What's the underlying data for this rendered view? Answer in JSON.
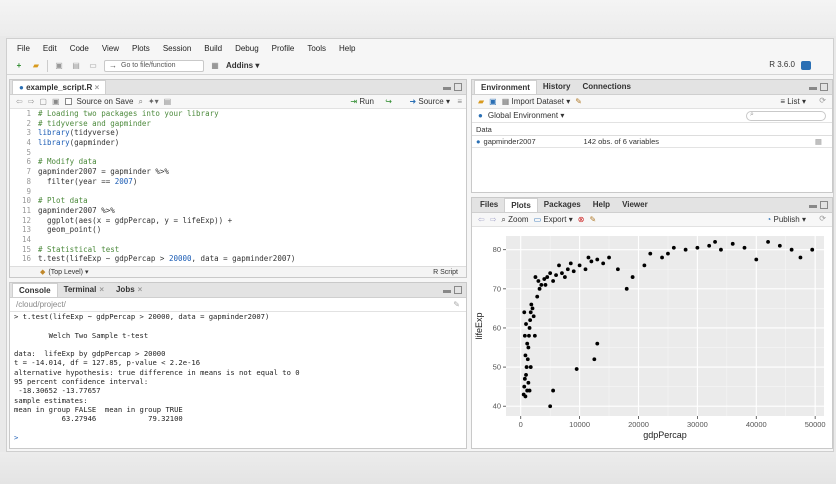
{
  "menu": [
    "File",
    "Edit",
    "Code",
    "View",
    "Plots",
    "Session",
    "Build",
    "Debug",
    "Profile",
    "Tools",
    "Help"
  ],
  "toolbar": {
    "goto_placeholder": "Go to file/function",
    "addins": "Addins",
    "r_version": "R 3.6.0"
  },
  "editor": {
    "tab": "example_script.R",
    "source_on_save": "Source on Save",
    "run": "Run",
    "source": "Source",
    "status_left": "(Top Level)",
    "status_right": "R Script",
    "lines": [
      {
        "n": "1",
        "parts": [
          [
            "cm",
            "# Loading two packages into your library"
          ]
        ]
      },
      {
        "n": "2",
        "parts": [
          [
            "cm",
            "# tidyverse and gapminder"
          ]
        ]
      },
      {
        "n": "3",
        "parts": [
          [
            "fn",
            "library"
          ],
          [
            "",
            "(tidyverse)"
          ]
        ]
      },
      {
        "n": "4",
        "parts": [
          [
            "fn",
            "library"
          ],
          [
            "",
            "(gapminder)"
          ]
        ]
      },
      {
        "n": "5",
        "parts": [
          [
            "",
            ""
          ]
        ]
      },
      {
        "n": "6",
        "parts": [
          [
            "cm",
            "# Modify data"
          ]
        ]
      },
      {
        "n": "7",
        "parts": [
          [
            "",
            "gapminder2007 = gapminder %>%"
          ]
        ]
      },
      {
        "n": "8",
        "parts": [
          [
            "",
            "  filter(year == "
          ],
          [
            "num",
            "2007"
          ],
          [
            "",
            ")"
          ]
        ]
      },
      {
        "n": "9",
        "parts": [
          [
            "",
            ""
          ]
        ]
      },
      {
        "n": "10",
        "parts": [
          [
            "cm",
            "# Plot data"
          ]
        ]
      },
      {
        "n": "11",
        "parts": [
          [
            "",
            "gapminder2007 %>%"
          ]
        ]
      },
      {
        "n": "12",
        "parts": [
          [
            "",
            "  ggplot(aes(x = gdpPercap, y = lifeExp)) +"
          ]
        ]
      },
      {
        "n": "13",
        "parts": [
          [
            "",
            "  geom_point()"
          ]
        ]
      },
      {
        "n": "14",
        "parts": [
          [
            "",
            ""
          ]
        ]
      },
      {
        "n": "15",
        "parts": [
          [
            "cm",
            "# Statistical test"
          ]
        ]
      },
      {
        "n": "16",
        "parts": [
          [
            "",
            "t.test(lifeExp ~ gdpPercap > "
          ],
          [
            "num",
            "20000"
          ],
          [
            "",
            ", data = gapminder2007)"
          ]
        ]
      }
    ]
  },
  "console": {
    "tabs": [
      "Console",
      "Terminal",
      "Jobs"
    ],
    "path": "/cloud/project/",
    "lines": [
      "> t.test(lifeExp ~ gdpPercap > 20000, data = gapminder2007)",
      "",
      "        Welch Two Sample t-test",
      "",
      "data:  lifeExp by gdpPercap > 20000",
      "t = -14.014, df = 127.85, p-value < 2.2e-16",
      "alternative hypothesis: true difference in means is not equal to 0",
      "95 percent confidence interval:",
      " -18.30652 -13.77657",
      "sample estimates:",
      "mean in group FALSE  mean in group TRUE",
      "           63.27946            79.32100",
      "",
      ">"
    ]
  },
  "environment": {
    "tabs": [
      "Environment",
      "History",
      "Connections"
    ],
    "import": "Import Dataset",
    "list": "List",
    "scope": "Global Environment",
    "section": "Data",
    "rows": [
      {
        "name": "gapminder2007",
        "desc": "142 obs. of 6 variables"
      }
    ]
  },
  "plots": {
    "tabs": [
      "Files",
      "Plots",
      "Packages",
      "Help",
      "Viewer"
    ],
    "zoom": "Zoom",
    "export": "Export",
    "publish": "Publish"
  },
  "chart_data": {
    "type": "scatter",
    "xlabel": "gdpPercap",
    "ylabel": "lifeExp",
    "xlim": [
      -2500,
      51500
    ],
    "ylim": [
      37.5,
      83.5
    ],
    "xticks": [
      0,
      10000,
      20000,
      30000,
      40000,
      50000
    ],
    "yticks": [
      40,
      50,
      60,
      70,
      80
    ],
    "points": [
      [
        500,
        43
      ],
      [
        600,
        45
      ],
      [
        700,
        47
      ],
      [
        800,
        42.5
      ],
      [
        900,
        48
      ],
      [
        1000,
        50
      ],
      [
        1100,
        44
      ],
      [
        1200,
        52
      ],
      [
        1300,
        55
      ],
      [
        1400,
        58
      ],
      [
        1500,
        60
      ],
      [
        1600,
        62
      ],
      [
        1700,
        64
      ],
      [
        1800,
        66
      ],
      [
        2000,
        65
      ],
      [
        2200,
        63
      ],
      [
        2500,
        73
      ],
      [
        3000,
        72
      ],
      [
        3500,
        71
      ],
      [
        4000,
        72.5
      ],
      [
        4500,
        73
      ],
      [
        5000,
        74
      ],
      [
        5500,
        72
      ],
      [
        6000,
        73.5
      ],
      [
        7000,
        74
      ],
      [
        8000,
        75
      ],
      [
        9000,
        74.5
      ],
      [
        10000,
        76
      ],
      [
        11000,
        75
      ],
      [
        12000,
        77
      ],
      [
        13000,
        77.5
      ],
      [
        14000,
        76.5
      ],
      [
        18000,
        70
      ],
      [
        19000,
        73
      ],
      [
        21000,
        76
      ],
      [
        24000,
        78
      ],
      [
        25000,
        79
      ],
      [
        28000,
        80
      ],
      [
        30000,
        80.5
      ],
      [
        32000,
        81
      ],
      [
        34000,
        80
      ],
      [
        36000,
        81.5
      ],
      [
        38000,
        80.5
      ],
      [
        40000,
        77.5
      ],
      [
        42000,
        82
      ],
      [
        47500,
        78
      ],
      [
        49500,
        80
      ],
      [
        5000,
        40
      ],
      [
        5500,
        44
      ],
      [
        9500,
        49.5
      ],
      [
        12500,
        52
      ],
      [
        13000,
        56
      ],
      [
        700,
        58
      ],
      [
        900,
        61
      ],
      [
        1100,
        56
      ],
      [
        1300,
        46
      ],
      [
        1500,
        44
      ],
      [
        1700,
        50
      ],
      [
        800,
        53
      ],
      [
        600,
        64
      ],
      [
        2400,
        58
      ],
      [
        2800,
        68
      ],
      [
        3200,
        70
      ],
      [
        4200,
        71
      ],
      [
        6500,
        76
      ],
      [
        7500,
        73
      ],
      [
        8500,
        76.5
      ],
      [
        11500,
        78
      ],
      [
        15000,
        78
      ],
      [
        16500,
        75
      ],
      [
        22000,
        79
      ],
      [
        26000,
        80.5
      ],
      [
        33000,
        82
      ],
      [
        44000,
        81
      ],
      [
        46000,
        80
      ]
    ]
  }
}
